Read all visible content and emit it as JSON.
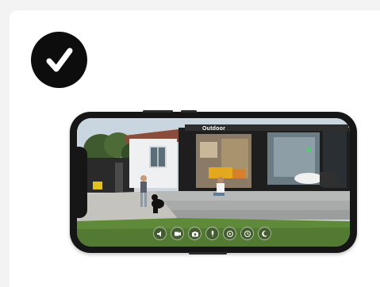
{
  "colors": {
    "background": "#f3f3f3",
    "card": "#ffffff",
    "badge": "#0d0d0d",
    "phone_frame": "#161616"
  },
  "badge": {
    "icon": "checkmark-icon"
  },
  "phone": {
    "camera_label": "Outdoor",
    "controls": [
      {
        "icon": "speaker-icon"
      },
      {
        "icon": "video-record-icon"
      },
      {
        "icon": "snapshot-icon"
      },
      {
        "icon": "microphone-icon"
      },
      {
        "icon": "playback-icon"
      },
      {
        "icon": "siren-icon"
      },
      {
        "icon": "alarm-icon"
      }
    ]
  }
}
